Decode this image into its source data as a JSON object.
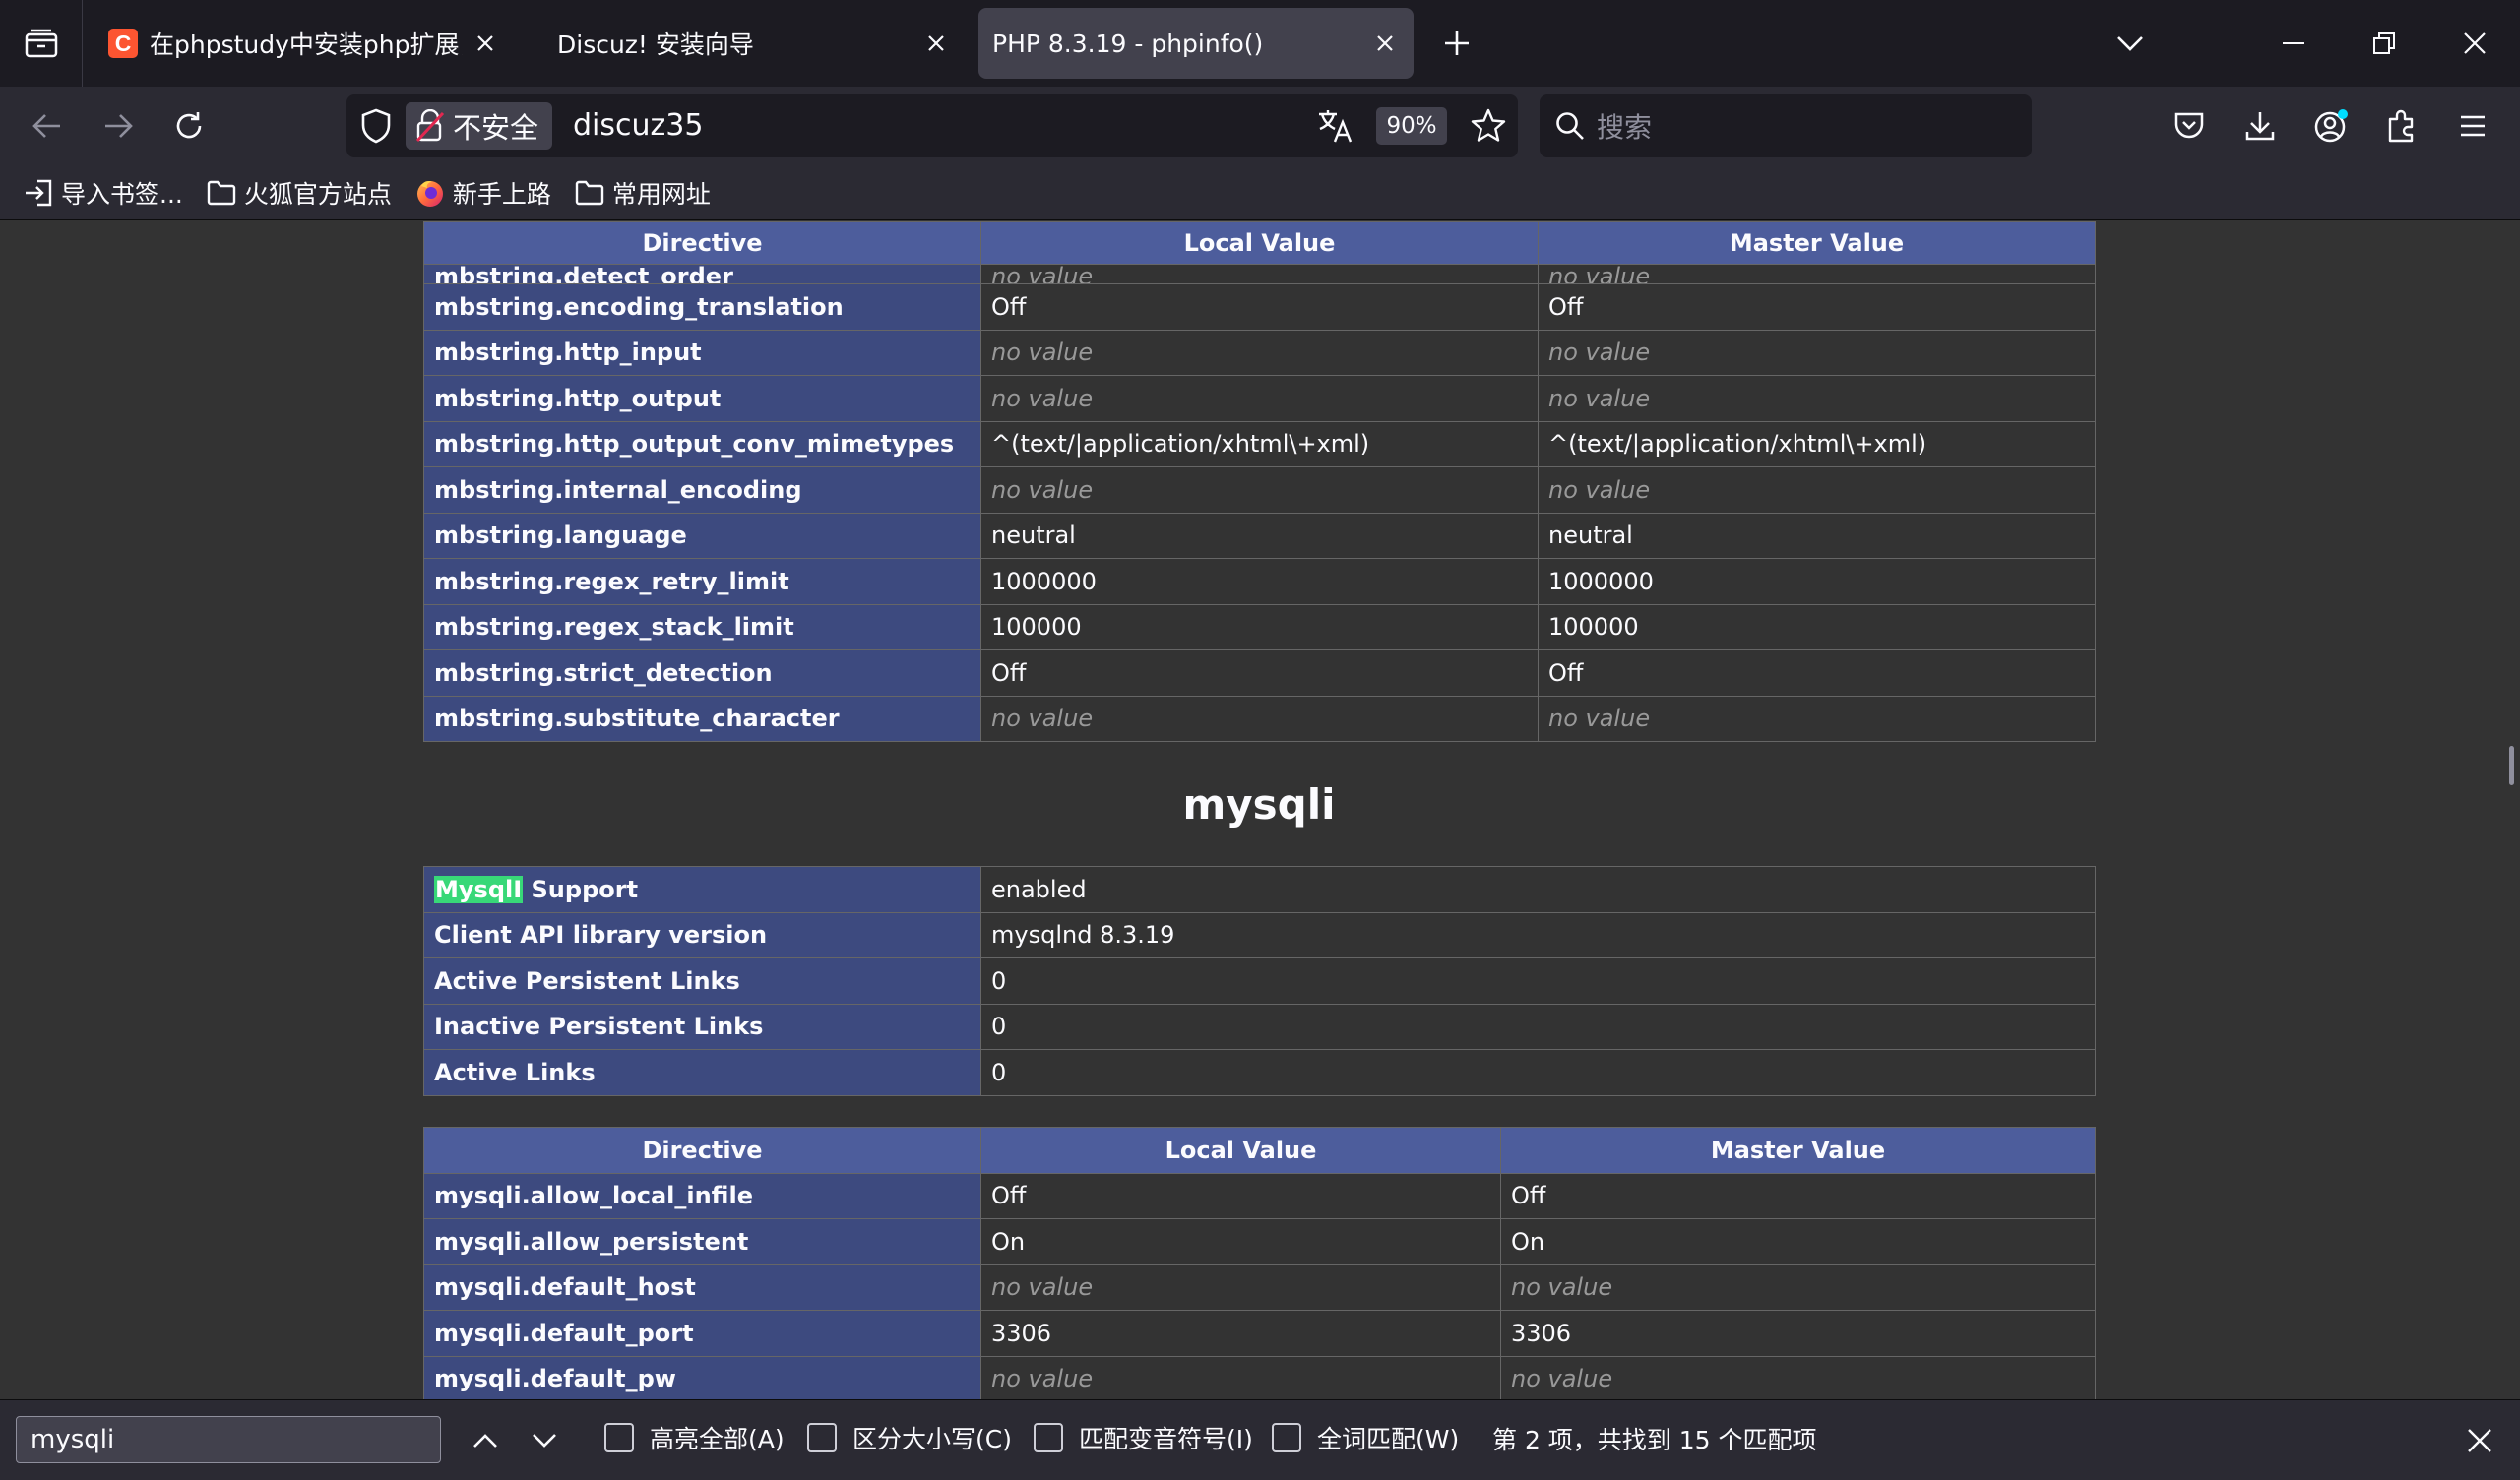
{
  "tabs": [
    {
      "favicon_letter": "C",
      "title": "在phpstudy中安装php扩展，如何",
      "active": false
    },
    {
      "title": "Discuz! 安装向导",
      "active": false
    },
    {
      "title": "PHP 8.3.19 - phpinfo()",
      "active": true
    }
  ],
  "navbar": {
    "security_label": "不安全",
    "url": "discuz35",
    "zoom": "90%",
    "search_placeholder": "搜索"
  },
  "bookmarks": [
    {
      "label": "导入书签...",
      "icon": "import-icon"
    },
    {
      "label": "火狐官方站点",
      "icon": "folder-icon"
    },
    {
      "label": "新手上路",
      "icon": "firefox-icon"
    },
    {
      "label": "常用网址",
      "icon": "folder-icon"
    }
  ],
  "mbstring_table": {
    "headers": [
      "Directive",
      "Local Value",
      "Master Value"
    ],
    "rows": [
      {
        "directive": "mbstring.detect_order",
        "local": "no value",
        "master": "no value",
        "novalue": true
      },
      {
        "directive": "mbstring.encoding_translation",
        "local": "Off",
        "master": "Off",
        "novalue": false
      },
      {
        "directive": "mbstring.http_input",
        "local": "no value",
        "master": "no value",
        "novalue": true
      },
      {
        "directive": "mbstring.http_output",
        "local": "no value",
        "master": "no value",
        "novalue": true
      },
      {
        "directive": "mbstring.http_output_conv_mimetypes",
        "local": "^(text/|application/xhtml\\+xml)",
        "master": "^(text/|application/xhtml\\+xml)",
        "novalue": false
      },
      {
        "directive": "mbstring.internal_encoding",
        "local": "no value",
        "master": "no value",
        "novalue": true
      },
      {
        "directive": "mbstring.language",
        "local": "neutral",
        "master": "neutral",
        "novalue": false
      },
      {
        "directive": "mbstring.regex_retry_limit",
        "local": "1000000",
        "master": "1000000",
        "novalue": false
      },
      {
        "directive": "mbstring.regex_stack_limit",
        "local": "100000",
        "master": "100000",
        "novalue": false
      },
      {
        "directive": "mbstring.strict_detection",
        "local": "Off",
        "master": "Off",
        "novalue": false
      },
      {
        "directive": "mbstring.substitute_character",
        "local": "no value",
        "master": "no value",
        "novalue": true
      }
    ]
  },
  "mysqli_heading": "mysqli",
  "mysqli_info": {
    "highlight_word": "MysqlI",
    "first_label_rest": " Support",
    "first_value": "enabled",
    "rows": [
      {
        "label": "Client API library version",
        "value": "mysqlnd 8.3.19"
      },
      {
        "label": "Active Persistent Links",
        "value": "0"
      },
      {
        "label": "Inactive Persistent Links",
        "value": "0"
      },
      {
        "label": "Active Links",
        "value": "0"
      }
    ]
  },
  "mysqli_table": {
    "headers": [
      "Directive",
      "Local Value",
      "Master Value"
    ],
    "rows": [
      {
        "directive": "mysqli.allow_local_infile",
        "local": "Off",
        "master": "Off",
        "novalue": false
      },
      {
        "directive": "mysqli.allow_persistent",
        "local": "On",
        "master": "On",
        "novalue": false
      },
      {
        "directive": "mysqli.default_host",
        "local": "no value",
        "master": "no value",
        "novalue": true
      },
      {
        "directive": "mysqli.default_port",
        "local": "3306",
        "master": "3306",
        "novalue": false
      },
      {
        "directive": "mysqli.default_pw",
        "local": "no value",
        "master": "no value",
        "novalue": true
      }
    ]
  },
  "findbar": {
    "query": "mysqli",
    "options": [
      "高亮全部(A)",
      "区分大小写(C)",
      "匹配变音符号(I)",
      "全词匹配(W)"
    ],
    "status": "第 2 项，共找到 15 个匹配项"
  }
}
